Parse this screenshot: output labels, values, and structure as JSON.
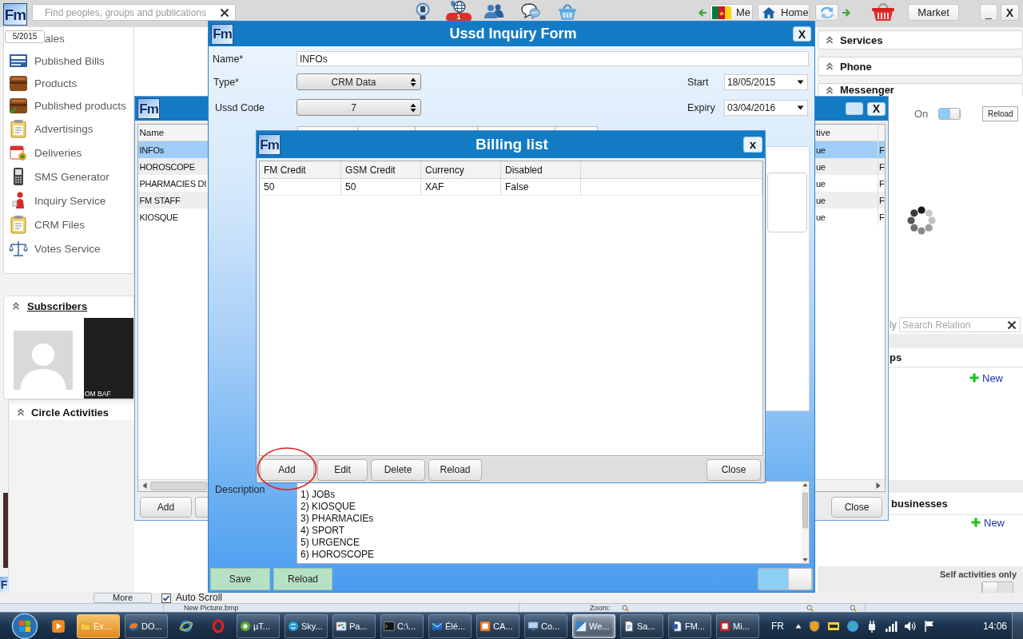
{
  "top_bar": {
    "logo": "Fm",
    "search": {
      "placeholder": "Find peoples, groups and publications"
    },
    "badge": "1",
    "me_button": "Me",
    "home_button": "Home",
    "market_button": "Market",
    "minimize_button": "_",
    "close_button": "X"
  },
  "sidebar": {
    "date_tag": "5/2015",
    "items": [
      {
        "label": "ales"
      },
      {
        "label": "Published Bills"
      },
      {
        "label": "Products"
      },
      {
        "label": "Published products"
      },
      {
        "label": "Advertisings"
      },
      {
        "label": "Deliveries"
      },
      {
        "label": "SMS Generator"
      },
      {
        "label": "Inquiry Service"
      },
      {
        "label": "CRM Files"
      },
      {
        "label": "Votes Service"
      }
    ]
  },
  "subscribers": {
    "title": "Subscribers",
    "tiles": [
      {
        "kind": "avatar"
      },
      {
        "kind": "photo",
        "caption": "OM BAF"
      }
    ]
  },
  "circle_activities": {
    "title": "Circle Activities",
    "more_button": "More",
    "auto_scroll": {
      "label": "Auto Scroll",
      "checked": true
    }
  },
  "left_edge": {
    "logo": "F"
  },
  "right_panel": {
    "headers": [
      "Services",
      "Phone",
      "Messenger"
    ],
    "status": {
      "label": "On",
      "on": true
    },
    "reload_button": "Reload",
    "search": {
      "label": "ly",
      "placeholder": "Search Relation"
    },
    "sections": [
      {
        "title": "ps",
        "new_link": "New"
      },
      {
        "title": "businesses",
        "new_link": "New"
      }
    ],
    "self_activities": {
      "label": "Self activities only",
      "on": false
    }
  },
  "list_window": {
    "logo": "Fm",
    "close_button": "X",
    "columns": [
      "Name",
      "tive"
    ],
    "rows": [
      {
        "cells": [
          "INFOs",
          "ue",
          "F"
        ],
        "selected": true
      },
      {
        "cells": [
          "HOROSCOPE",
          "ue",
          "F"
        ],
        "selected": false
      },
      {
        "cells": [
          "PHARMACIES DI",
          "ue",
          "F"
        ],
        "selected": false
      },
      {
        "cells": [
          "FM STAFF",
          "ue",
          "F"
        ],
        "selected": false
      },
      {
        "cells": [
          "KIOSQUE",
          "ue",
          "F"
        ],
        "selected": false
      }
    ],
    "add_button": "Add",
    "close_action": "Close"
  },
  "ussd_form": {
    "logo": "Fm",
    "title": "Ussd Inquiry Form",
    "close_button": "X",
    "fields": [
      {
        "kind": "text",
        "label": "Name*",
        "value": "INFOs"
      },
      {
        "kind": "select",
        "label": "Type*",
        "value": "CRM Data"
      },
      {
        "kind": "select",
        "label": "Ussd Code",
        "value": "7"
      }
    ],
    "dates": [
      {
        "label": "Start",
        "value": "18/05/2015"
      },
      {
        "label": "Expiry",
        "value": "03/04/2016"
      }
    ],
    "description": {
      "label": "Description",
      "value": "1) JOBs\n2) KIOSQUE\n3) PHARMACIEs\n4) SPORT\n5) URGENCE\n6) HOROSCOPE"
    },
    "buttons": [
      "Save",
      "Reload"
    ],
    "toggle_on": true
  },
  "billing_list": {
    "logo": "Fm",
    "title": "Billing list",
    "close_button": "x",
    "columns": [
      "FM Credit",
      "GSM Credit",
      "Currency",
      "Disabled"
    ],
    "rows": [
      {
        "cells": [
          "50",
          "50",
          "XAF",
          "False"
        ],
        "selected": false
      }
    ],
    "buttons": [
      {
        "label": "Add",
        "circled": true
      },
      {
        "label": "Edit",
        "circled": false
      },
      {
        "label": "Delete",
        "circled": false
      },
      {
        "label": "Reload",
        "circled": false
      }
    ],
    "close_action": "Close"
  },
  "status_strip": {
    "file_name": "New Picture.bmp",
    "zoom_label": "Zoom:"
  },
  "taskbar": {
    "tasks": [
      {
        "kind": "pinned"
      },
      {
        "kind": "app",
        "label": "Ex...",
        "selected": false,
        "flashing": true
      },
      {
        "kind": "app",
        "label": "DO...",
        "selected": false,
        "flashing": false
      },
      {
        "kind": "pinned"
      },
      {
        "kind": "pinned"
      },
      {
        "kind": "app",
        "label": "µT...",
        "selected": false,
        "flashing": false
      },
      {
        "kind": "app",
        "label": "Sky...",
        "selected": false,
        "flashing": false
      },
      {
        "kind": "app",
        "label": "Pa...",
        "selected": false,
        "flashing": false
      },
      {
        "kind": "app",
        "label": "C:\\...",
        "selected": false,
        "flashing": false
      },
      {
        "kind": "app",
        "label": "Élé...",
        "selected": false,
        "flashing": false
      },
      {
        "kind": "app",
        "label": "CA...",
        "selected": false,
        "flashing": false
      },
      {
        "kind": "app",
        "label": "Co...",
        "selected": false,
        "flashing": false
      },
      {
        "kind": "app",
        "label": "We...",
        "selected": true,
        "flashing": false
      },
      {
        "kind": "app",
        "label": "Sa...",
        "selected": false,
        "flashing": false
      },
      {
        "kind": "app",
        "label": "FM...",
        "selected": false,
        "flashing": false
      },
      {
        "kind": "app",
        "label": "Mi...",
        "selected": false,
        "flashing": false
      }
    ],
    "language": "FR",
    "clock": "14:06"
  }
}
